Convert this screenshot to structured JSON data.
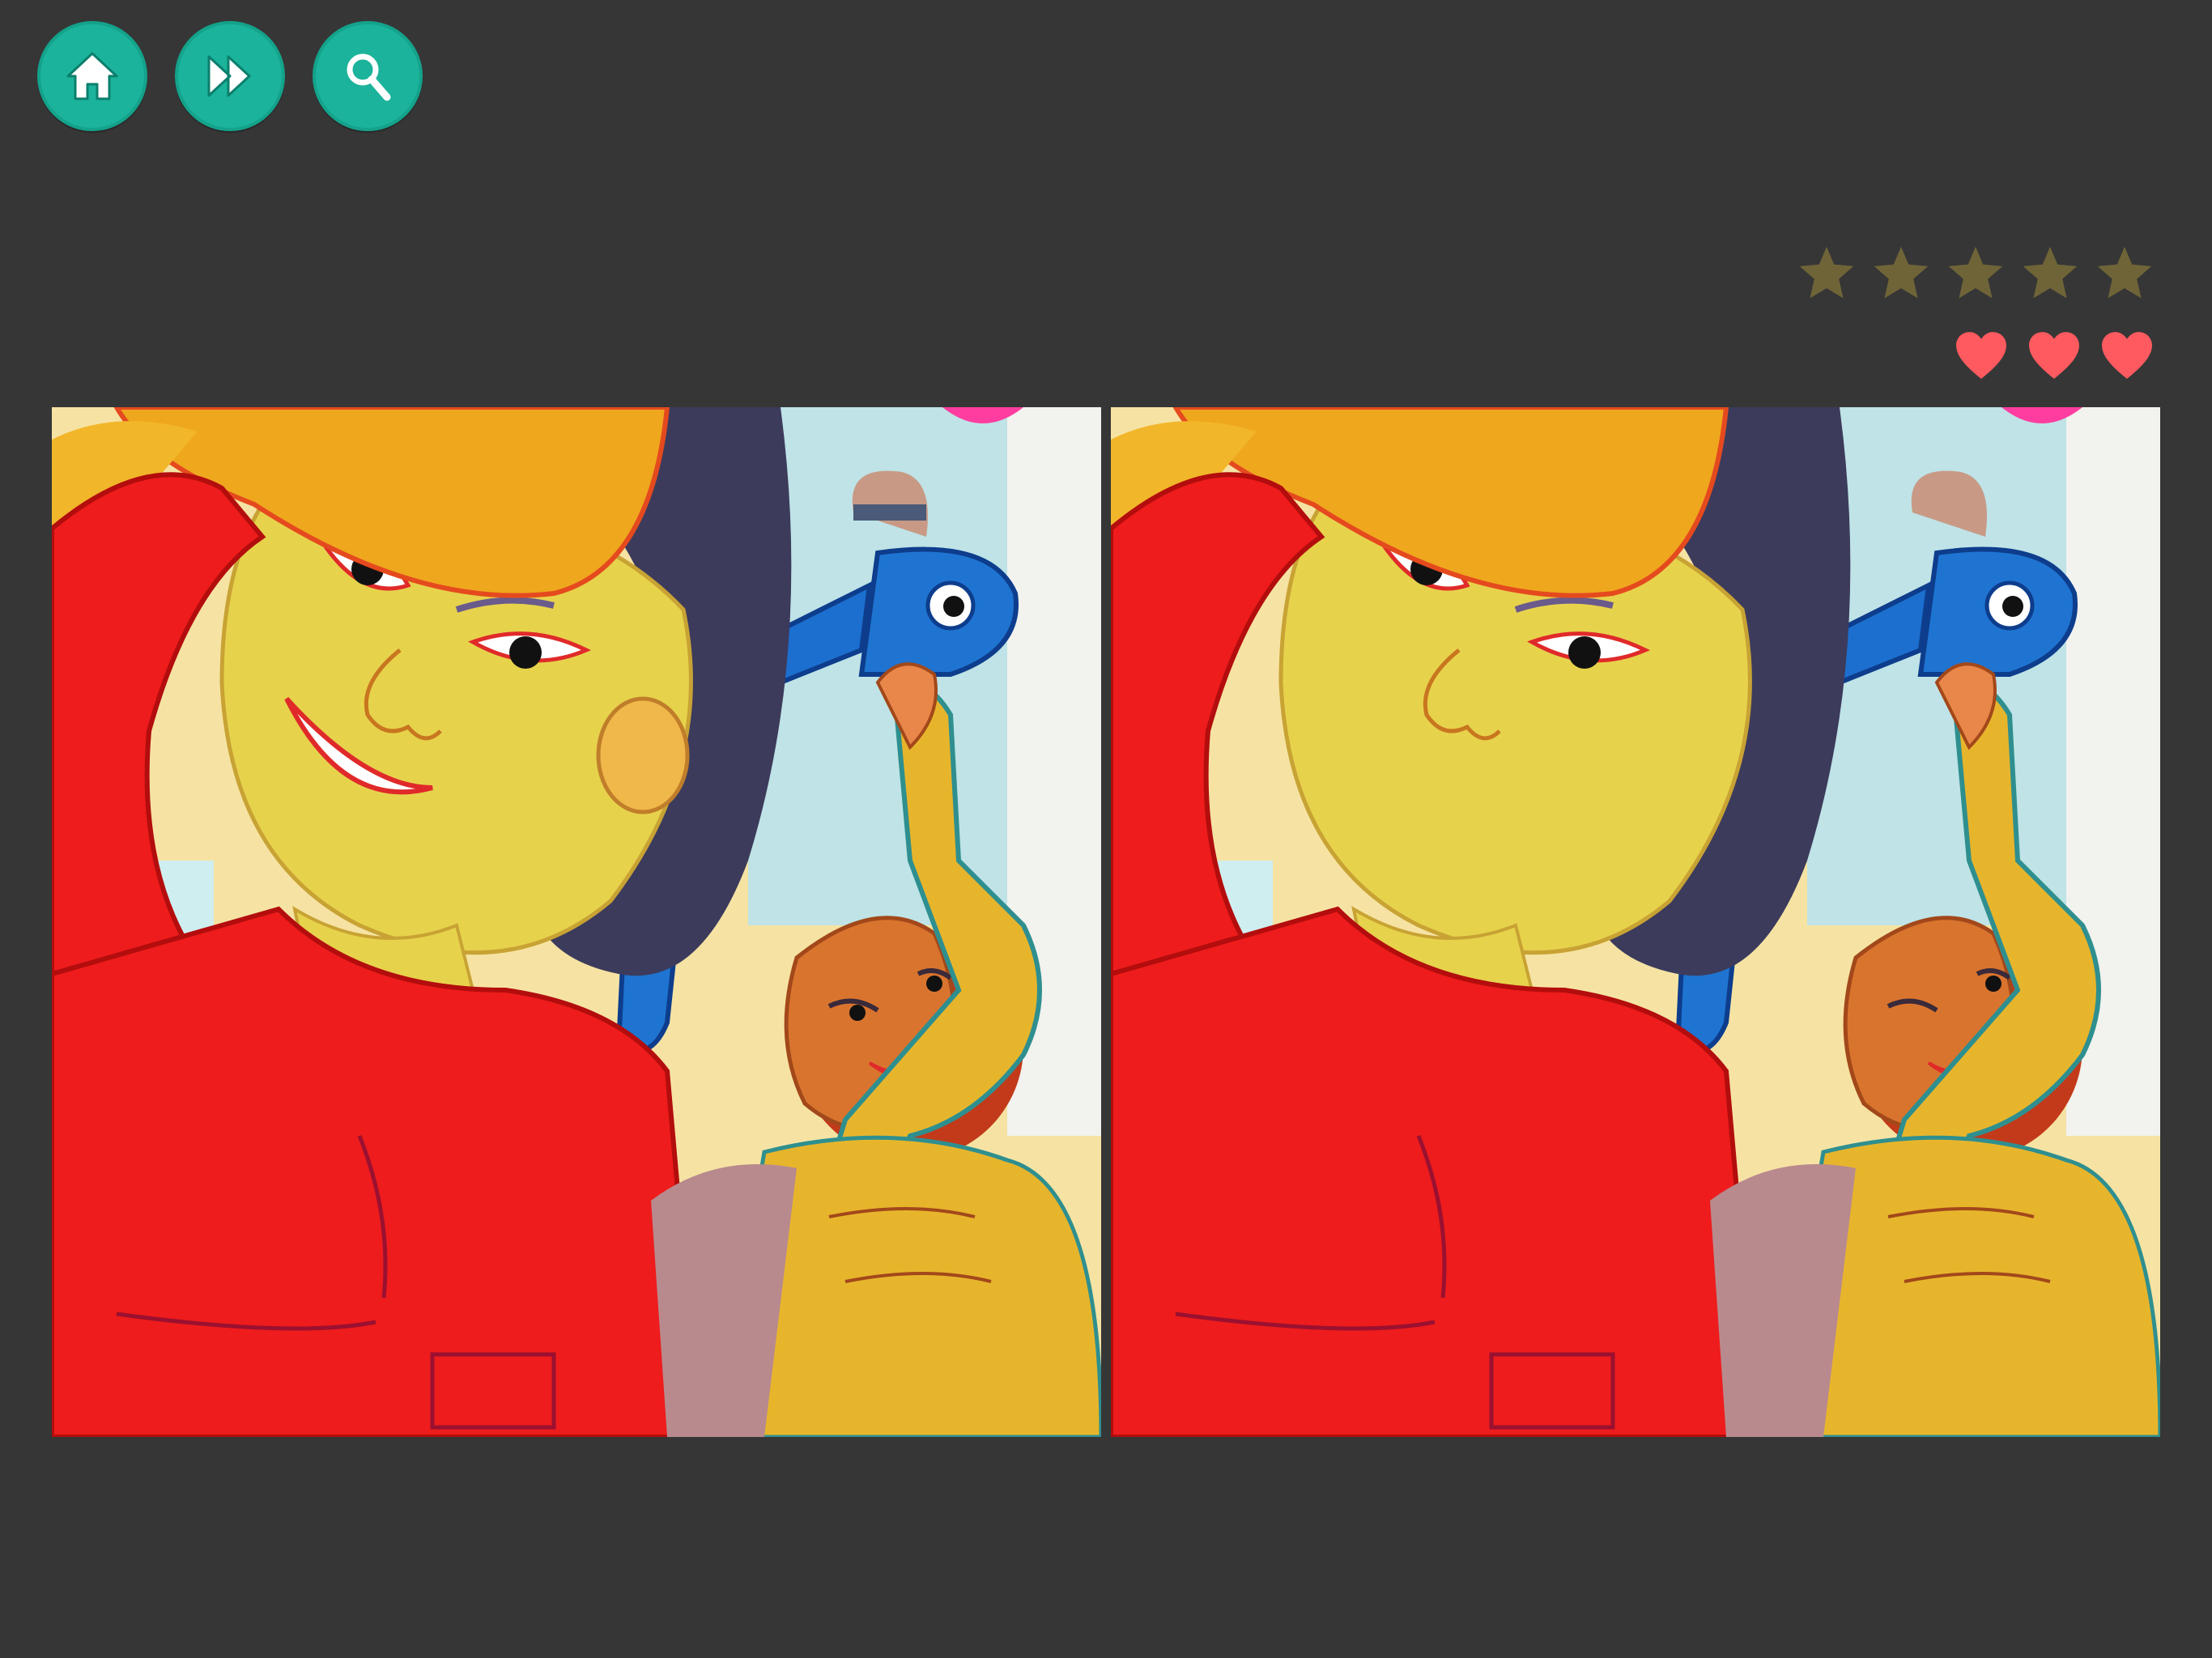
{
  "toolbar": {
    "buttons": [
      {
        "icon": "home-icon"
      },
      {
        "icon": "fast-forward-icon"
      },
      {
        "icon": "magnifier-icon"
      }
    ],
    "button_color": "#1bb39b"
  },
  "progress": {
    "stars_total": 5,
    "stars_earned": 0,
    "star_color": "#6f6438",
    "hearts_remaining": 3,
    "heart_color": "#ff5a5f"
  },
  "puzzle": {
    "panels": [
      "left-image",
      "right-image"
    ],
    "artwork": "mural-boy-yellow-hat-girl-blue-plane"
  }
}
